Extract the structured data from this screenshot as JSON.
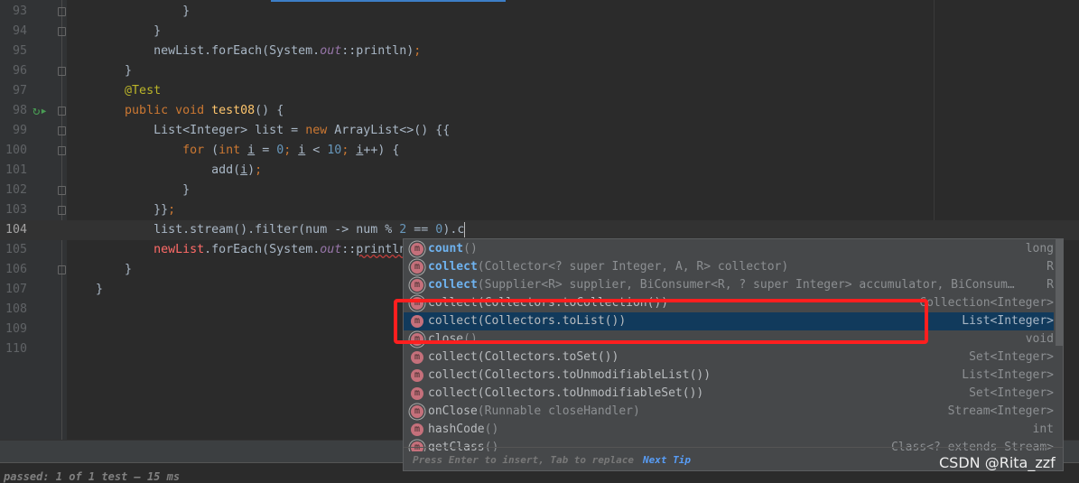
{
  "editor": {
    "current_line": 104,
    "lines": [
      {
        "n": "93",
        "tokens": [
          [
            "                }",
            ""
          ]
        ]
      },
      {
        "n": "94",
        "tokens": [
          [
            "            }",
            ""
          ]
        ]
      },
      {
        "n": "95",
        "tokens": [
          [
            "            newList.forEach(System.",
            ""
          ],
          [
            "out",
            "st"
          ],
          [
            "::println)",
            ""
          ],
          [
            ";",
            "semi"
          ]
        ]
      },
      {
        "n": "96",
        "tokens": [
          [
            "        }",
            ""
          ]
        ]
      },
      {
        "n": "97",
        "tokens": [
          [
            "        ",
            ""
          ],
          [
            "@Test",
            "an"
          ]
        ]
      },
      {
        "n": "98",
        "tokens": [
          [
            "        ",
            ""
          ],
          [
            "public void ",
            "kw"
          ],
          [
            "test08",
            "fn"
          ],
          [
            "() {",
            ""
          ]
        ]
      },
      {
        "n": "99",
        "tokens": [
          [
            "            List<Integer> list = ",
            ""
          ],
          [
            "new ",
            "kw"
          ],
          [
            "ArrayList<>() {{",
            ""
          ]
        ]
      },
      {
        "n": "100",
        "tokens": [
          [
            "                ",
            ""
          ],
          [
            "for ",
            "kw"
          ],
          [
            "(",
            ""
          ],
          [
            "int ",
            "kw"
          ],
          [
            "i",
            "ul"
          ],
          [
            " = ",
            ""
          ],
          [
            "0",
            "num"
          ],
          [
            "; ",
            "semi"
          ],
          [
            "i",
            "ul"
          ],
          [
            " < ",
            ""
          ],
          [
            "10",
            "num"
          ],
          [
            "; ",
            "semi"
          ],
          [
            "i",
            "ul"
          ],
          [
            "++) {",
            ""
          ]
        ]
      },
      {
        "n": "101",
        "tokens": [
          [
            "                    add(",
            ""
          ],
          [
            "i",
            "ul"
          ],
          [
            ")",
            ""
          ],
          [
            ";",
            "semi"
          ]
        ]
      },
      {
        "n": "102",
        "tokens": [
          [
            "                }",
            ""
          ]
        ]
      },
      {
        "n": "103",
        "tokens": [
          [
            "            }}",
            ""
          ],
          [
            ";",
            "semi"
          ]
        ]
      },
      {
        "n": "104",
        "tokens": [
          [
            "            list.stream().filter(num -> num % ",
            ""
          ],
          [
            "2",
            "num"
          ],
          [
            " == ",
            ""
          ],
          [
            "0",
            "num"
          ],
          [
            ").c",
            ""
          ]
        ]
      },
      {
        "n": "105",
        "tokens": [
          [
            "            ",
            ""
          ],
          [
            "newList",
            "err"
          ],
          [
            ".forEach(System.",
            ""
          ],
          [
            "out",
            "st"
          ],
          [
            "::",
            ""
          ],
          [
            "println",
            "wavy"
          ],
          [
            ")",
            ""
          ],
          [
            ";",
            "semi"
          ]
        ]
      },
      {
        "n": "106",
        "tokens": [
          [
            "        }",
            ""
          ]
        ]
      },
      {
        "n": "107",
        "tokens": [
          [
            "    }",
            ""
          ]
        ]
      },
      {
        "n": "108",
        "tokens": []
      },
      {
        "n": "109",
        "tokens": []
      },
      {
        "n": "110",
        "tokens": []
      }
    ]
  },
  "completion": {
    "items": [
      {
        "bold": "count",
        "rest": "",
        "params": "()",
        "type": "long",
        "pinned": true
      },
      {
        "bold": "collect",
        "rest": "",
        "params": "(Collector<? super Integer, A, R> collector)",
        "type": "R",
        "pinned": true
      },
      {
        "bold": "collect",
        "rest": "",
        "params": "(Supplier<R> supplier, BiConsumer<R, ? super Integer> accumulator, BiConsum…",
        "type": "R",
        "pinned": true
      },
      {
        "bold": "",
        "rest": "collect(Collectors.toCollection())",
        "params": "",
        "type": "Collection<Integer>",
        "pinned": true
      },
      {
        "bold": "",
        "rest": "collect(Collectors.toList())",
        "params": "",
        "type": "List<Integer>",
        "pinned": false,
        "selected": true
      },
      {
        "bold": "",
        "rest": "close",
        "params": "()",
        "type": "void",
        "pinned": true
      },
      {
        "bold": "",
        "rest": "collect(Collectors.toSet())",
        "params": "",
        "type": "Set<Integer>",
        "pinned": false
      },
      {
        "bold": "",
        "rest": "collect(Collectors.toUnmodifiableList())",
        "params": "",
        "type": "List<Integer>",
        "pinned": false
      },
      {
        "bold": "",
        "rest": "collect(Collectors.toUnmodifiableSet())",
        "params": "",
        "type": "Set<Integer>",
        "pinned": false
      },
      {
        "bold": "",
        "rest": "onClose",
        "params": "(Runnable closeHandler)",
        "type": "Stream<Integer>",
        "pinned": true
      },
      {
        "bold": "",
        "rest": "hashCode",
        "params": "()",
        "type": "int",
        "pinned": false
      },
      {
        "bold": "",
        "rest": "getClass",
        "params": "()",
        "type": "Class<? extends Stream>",
        "pinned": true
      }
    ],
    "footer_hint": "Press Enter to insert, Tab to replace",
    "next_tip": "Next Tip",
    "icon_letter": "m"
  },
  "status": {
    "text": "passed: 1 of 1 test – 15 ms"
  },
  "watermark": "CSDN @Rita_zzf",
  "colors": {
    "accent": "#3d7ec7",
    "selection": "#113a5c",
    "highlight_box": "#ff1f1f"
  }
}
